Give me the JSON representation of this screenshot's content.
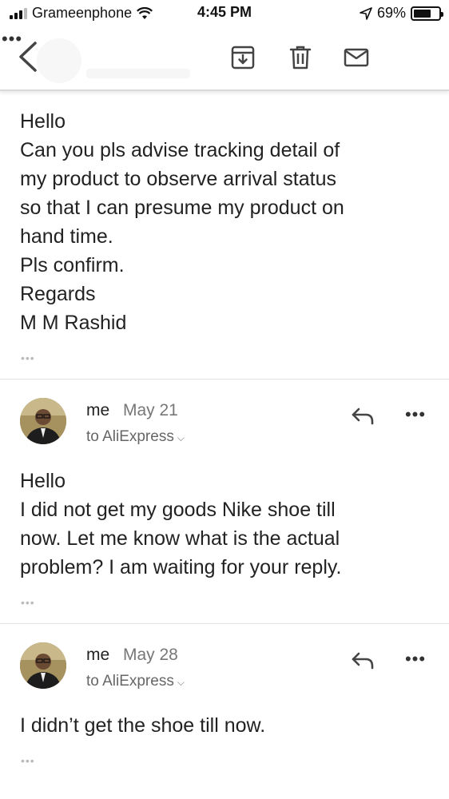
{
  "status_bar": {
    "carrier": "Grameenphone",
    "time": "4:45 PM",
    "battery_text": "69%",
    "battery_level": 0.69
  },
  "toolbar": {
    "back_icon": "chevron-left-icon",
    "actions": [
      "archive-icon",
      "trash-icon",
      "mail-icon",
      "more-horizontal-icon"
    ],
    "more_label": "•••"
  },
  "messages": [
    {
      "body": "Hello\nCan you pls advise tracking detail of\nmy product to observe arrival status\nso that  I can presume my product on\nhand time.\nPls confirm.\nRegards\nM M Rashid",
      "dots": "•••"
    },
    {
      "sender": "me",
      "date": "May 21",
      "recipient": "to AliExpress",
      "body": "Hello\nI did not get my goods Nike shoe till\nnow.  Let me know what is the actual\nproblem? I am waiting for your reply.",
      "dots": "•••",
      "more_label": "•••"
    },
    {
      "sender": "me",
      "date": "May 28",
      "recipient": "to AliExpress",
      "body": "I didn’t get the shoe till now.",
      "dots": "•••",
      "more_label": "•••"
    }
  ],
  "colors": {
    "text": "#222222",
    "muted": "#777777",
    "divider": "#e2e2e2",
    "icon": "#444444"
  }
}
